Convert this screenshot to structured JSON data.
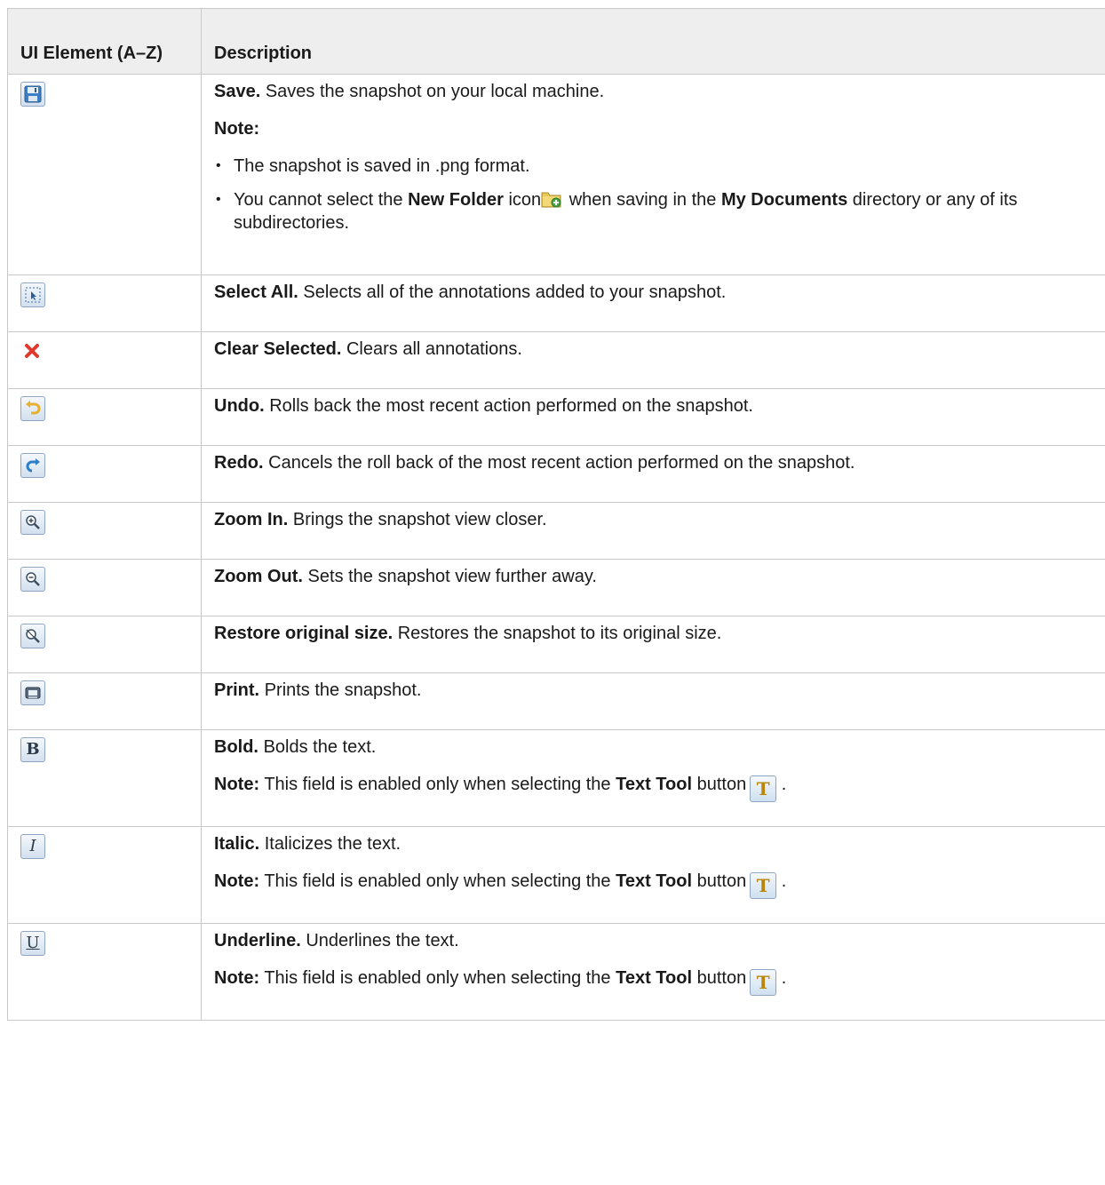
{
  "header": {
    "col1": "UI Element (A–Z)",
    "col2": "Description"
  },
  "rows": [
    {
      "icon": "save-icon",
      "name": "Save.",
      "desc": "Saves the snapshot on your local machine.",
      "note_label": "Note:",
      "bullets": {
        "b1": "The snapshot is saved in .png format.",
        "b2_pre": "You cannot select the",
        "b2_bold1": "New Folder",
        "b2_mid1": "icon",
        "b2_mid2": "when saving in the",
        "b2_bold2": "My Documents",
        "b2_post": "directory or any of its subdirectories."
      }
    },
    {
      "icon": "select-all-icon",
      "name": "Select All.",
      "desc": "Selects all of the annotations added to your snapshot."
    },
    {
      "icon": "clear-selected-icon",
      "name": "Clear Selected.",
      "desc": "Clears all annotations."
    },
    {
      "icon": "undo-icon",
      "name": "Undo.",
      "desc": "Rolls back the most recent action performed on the snapshot."
    },
    {
      "icon": "redo-icon",
      "name": "Redo.",
      "desc": "Cancels the roll back of the most recent action performed on the snapshot."
    },
    {
      "icon": "zoom-in-icon",
      "name": "Zoom In.",
      "desc": "Brings the snapshot view closer."
    },
    {
      "icon": "zoom-out-icon",
      "name": "Zoom Out.",
      "desc": "Sets the snapshot view further away."
    },
    {
      "icon": "restore-size-icon",
      "name": "Restore original size.",
      "desc": "Restores the snapshot to its original size."
    },
    {
      "icon": "print-icon",
      "name": "Print.",
      "desc": "Prints the snapshot."
    },
    {
      "icon": "bold-icon",
      "glyph": "B",
      "name": "Bold.",
      "desc": "Bolds the text.",
      "note_label": "Note:",
      "note_pre": "This field is enabled only when selecting the",
      "note_bold": "Text Tool",
      "note_post": "button",
      "note_end": "."
    },
    {
      "icon": "italic-icon",
      "glyph": "I",
      "name": "Italic.",
      "desc": "Italicizes the text.",
      "note_label": "Note:",
      "note_pre": "This field is enabled only when selecting the",
      "note_bold": "Text Tool",
      "note_post": "button",
      "note_end": "."
    },
    {
      "icon": "underline-icon",
      "glyph": "U",
      "name": "Underline.",
      "desc": "Underlines the text.",
      "note_label": "Note:",
      "note_pre": "This field is enabled only when selecting the",
      "note_bold": "Text Tool",
      "note_post": "button",
      "note_end": "."
    }
  ],
  "text_tool_glyph": "T"
}
